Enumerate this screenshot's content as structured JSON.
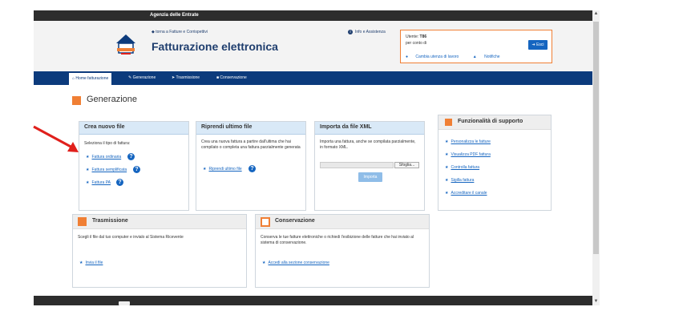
{
  "topbar": {
    "agency": "Agenzia delle Entrate"
  },
  "header": {
    "back_link": "torna a Fatture e Corrispettivi",
    "title": "Fatturazione elettronica",
    "info_link": "Info e Assistenza",
    "user": {
      "label": "Utente:",
      "code": "T86",
      "on_behalf": "per conto di",
      "exit_button": "Esci",
      "change_user": "Cambia utenza di lavoro",
      "notifications": "Notifiche"
    }
  },
  "nav": {
    "home": "Home fatturazione",
    "generation": "Generazione",
    "transmission": "Trasmissione",
    "conservation": "Conservazione"
  },
  "page": {
    "title": "Generazione"
  },
  "crea": {
    "title": "Crea nuovo file",
    "text": "Seleziona il tipo di fattura:",
    "links": [
      "Fattura ordinaria",
      "Fattura semplificata",
      "Fattura PA"
    ]
  },
  "riprendi": {
    "title": "Riprendi ultimo file",
    "text": "Crea una nuova fattura a partire dall'ultima che hai compilato o completa una fattura parzialmente generata",
    "link": "Riprendi ultimo file"
  },
  "importa": {
    "title": "Importa da file XML",
    "text": "Importa una fattura, anche se compilata parzialmente, in formato XML.",
    "browse_button": "Sfoglia...",
    "import_button": "Importa"
  },
  "supporto": {
    "title": "Funzionalità di supporto",
    "links": [
      "Personalizza le fatture",
      "Visualizza PDF fattura",
      "Controlla fattura",
      "Sigilla fattura",
      "Accreditare il canale"
    ]
  },
  "trasmissione": {
    "title": "Trasmissione",
    "text": "Scegli il file dal tuo computer e invialo al Sistema Ricevente",
    "link": "Invia il file"
  },
  "conservazione": {
    "title": "Conservazione",
    "text": "Conserva le tue fatture elettroniche o richiedi l'esibizione delle fatture che hai inviato al sistema di conservazione.",
    "link": "Accedi alla sezione conservazione"
  },
  "colors": {
    "navy": "#0c3b7c",
    "orange": "#f07f34",
    "link_blue": "#1565c0",
    "annotation_red": "#e0201c"
  }
}
